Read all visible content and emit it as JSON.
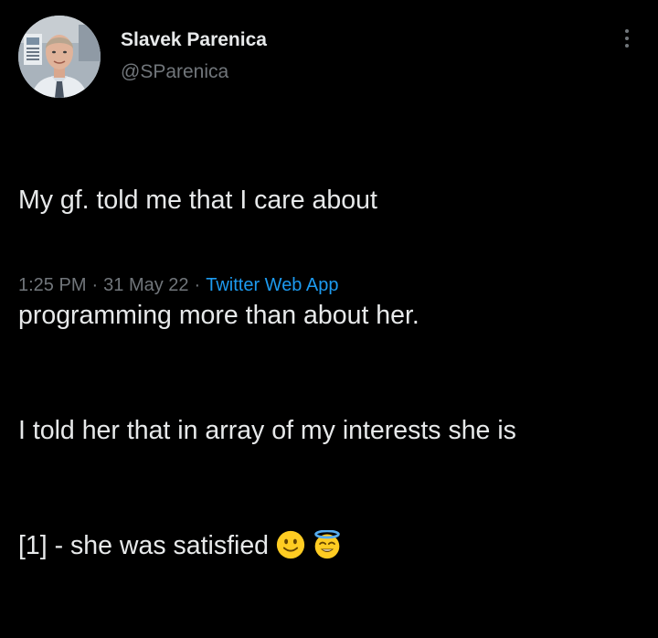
{
  "author": {
    "display_name": "Slavek Parenica",
    "handle": "@SParenica"
  },
  "tweet": {
    "line1": "My gf. told me that I care about",
    "line2": "programming more than about her.",
    "line3": "I told her that in array of my interests she is",
    "line4": "[1] - she was satisfied ",
    "emojis": [
      "slightly-smiling-face",
      "smiling-face-with-halo"
    ]
  },
  "meta": {
    "time": "1:25 PM",
    "separator": "·",
    "date": "31 May 22",
    "source": "Twitter Web App"
  },
  "colors": {
    "background": "#000000",
    "text": "#e7e9ea",
    "secondary": "#71767b",
    "link": "#1d9bf0",
    "emoji": "#ffcc22"
  }
}
